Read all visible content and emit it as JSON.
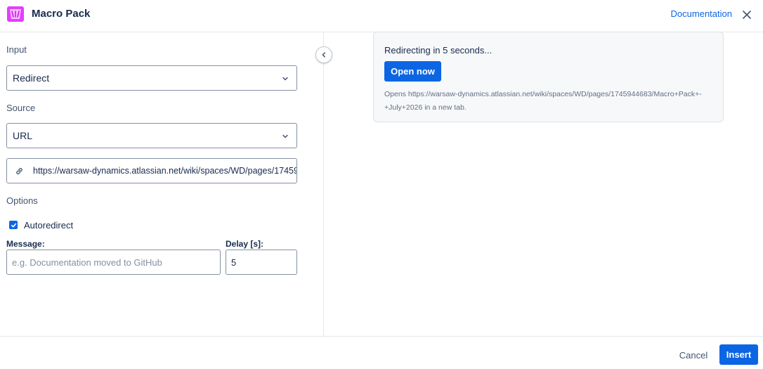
{
  "app": {
    "title": "Macro Pack",
    "logo_icon": "macro-pack-logo",
    "accent_color": "#e040fb"
  },
  "header": {
    "documentation_label": "Documentation",
    "close_icon": "close-icon"
  },
  "form": {
    "input": {
      "label": "Input",
      "selected": "Redirect"
    },
    "source": {
      "label": "Source",
      "selected": "URL",
      "url_value": "https://warsaw-dynamics.atlassian.net/wiki/spaces/WD/pages/1745944683/Macro+Pack+-+July+2026"
    },
    "options": {
      "label": "Options",
      "autoredirect_label": "Autoredirect",
      "autoredirect_checked": true,
      "message_label": "Message:",
      "message_placeholder": "e.g. Documentation moved to GitHub",
      "message_value": "",
      "delay_label": "Delay [s]:",
      "delay_value": "5"
    }
  },
  "preview": {
    "redirect_message": "Redirecting in 5 seconds...",
    "open_now_label": "Open now",
    "opens_text": "Opens https://warsaw-dynamics.atlassian.net/wiki/spaces/WD/pages/1745944683/Macro+Pack+-+July+2026 in a new tab."
  },
  "footer": {
    "cancel_label": "Cancel",
    "insert_label": "Insert"
  },
  "colors": {
    "primary": "#0c66e4",
    "border": "#8590a2",
    "divider": "#e4e6ea"
  }
}
